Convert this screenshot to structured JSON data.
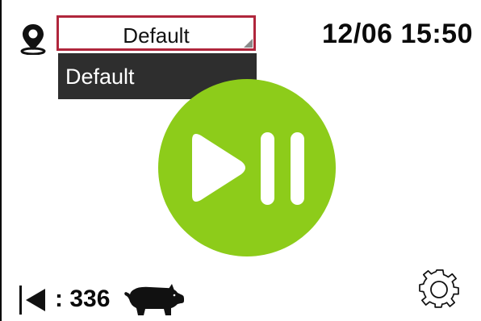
{
  "header": {
    "location_select": {
      "value": "Default",
      "options": [
        "Default"
      ]
    },
    "datetime": "12/06 15:50"
  },
  "main": {
    "control_icon": "play-pause-icon"
  },
  "footer": {
    "counter_text": ": 336",
    "counter_icon": "pig-icon",
    "back_icon": "back-arrow-icon",
    "settings_icon": "gear-icon"
  },
  "colors": {
    "accent_green": "#8dcc1a",
    "select_border": "#b0263c",
    "dropdown_bg": "#2e2e2e"
  }
}
